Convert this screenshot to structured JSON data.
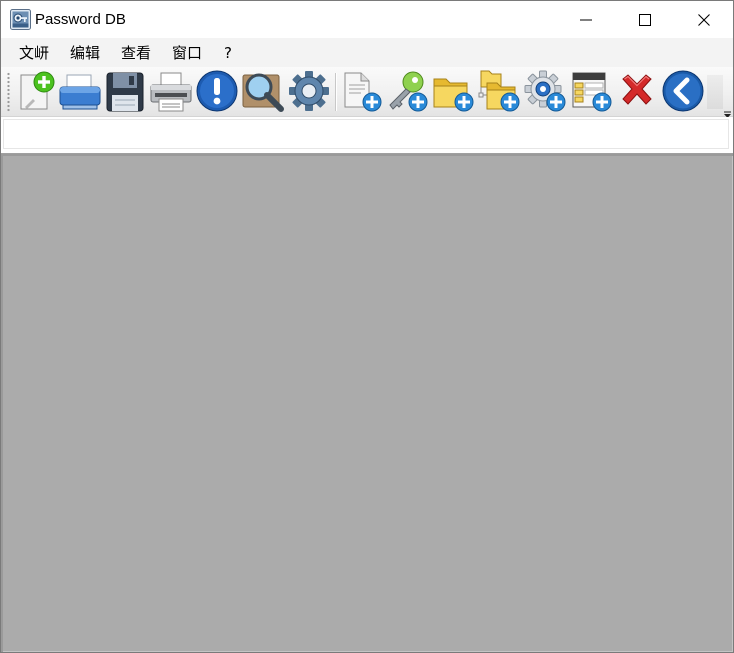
{
  "window": {
    "title": "Password DB",
    "app_icon": "password-db-app-icon",
    "controls": {
      "minimize": "minimize-icon",
      "maximize": "maximize-icon",
      "close": "close-icon"
    }
  },
  "menu": {
    "items": [
      {
        "label": "文岍"
      },
      {
        "label": "编辑"
      },
      {
        "label": "查看"
      },
      {
        "label": "窗口"
      },
      {
        "label": "?"
      }
    ]
  },
  "toolbar": {
    "buttons": [
      {
        "icon": "new-document-icon"
      },
      {
        "icon": "open-scanner-icon"
      },
      {
        "icon": "save-floppy-icon"
      },
      {
        "icon": "printer-icon"
      },
      {
        "icon": "alert-info-icon"
      },
      {
        "icon": "search-magnifier-icon"
      },
      {
        "icon": "settings-gear-icon"
      },
      {
        "icon": "add-page-icon"
      },
      {
        "icon": "add-key-icon"
      },
      {
        "icon": "add-folder-icon"
      },
      {
        "icon": "add-subfolder-icon"
      },
      {
        "icon": "add-config-icon"
      },
      {
        "icon": "add-table-icon"
      },
      {
        "icon": "delete-x-icon"
      },
      {
        "icon": "back-arrow-icon"
      }
    ],
    "overflow": "toolbar-overflow-icon"
  },
  "address_bar": {
    "value": "",
    "placeholder": ""
  },
  "colors": {
    "mdi_background": "#ababab",
    "menubar_background": "#f3f3f3",
    "accent_blue": "#1a5aa8",
    "add_badge_green": "#4cc21f",
    "add_badge_blue": "#2a8ad8",
    "folder_yellow": "#f3cf4a",
    "delete_red": "#d42a2a"
  }
}
